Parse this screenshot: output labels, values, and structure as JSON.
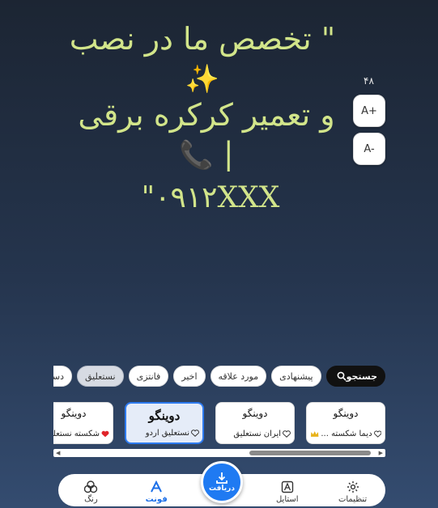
{
  "canvas": {
    "line1": "\" تخصص ما در نصب",
    "line2": "و تعمیر کرکره برقی |",
    "line3": "\"۰۹۱۲XXX",
    "sparkles_emoji": "✨",
    "phone_emoji": "📞",
    "text_color": "#d2e58a"
  },
  "size_control": {
    "value": "۴۸",
    "increase_label": "A+",
    "decrease_label": "A-"
  },
  "categories": {
    "search_label": "جستجو",
    "items": [
      "پیشنهادی",
      "مورد علاقه",
      "اخیر",
      "فانتزی",
      "نستعلیق",
      "دست‌نویس"
    ],
    "active": "نستعلیق"
  },
  "fonts": [
    {
      "preview": "دوینگو",
      "name": "دیما شکسته ...",
      "badge": "crown-icon"
    },
    {
      "preview": "دوینگو",
      "name": "ایران نستعلیق",
      "badge": "heart-outline-icon"
    },
    {
      "preview": "دوینگو",
      "name": "نستعلیق اردو",
      "badge": "heart-outline-icon",
      "selected": true
    },
    {
      "preview": "دوینگو",
      "name": "شکسته نستعلیق",
      "badge": "heart-filled-icon"
    }
  ],
  "nav": {
    "settings": "تنظیمات",
    "style": "استایل",
    "download": "دریافت",
    "font": "فونت",
    "color": "رنگ"
  },
  "colors": {
    "accent": "#1f7af2",
    "heart": "#e0242a",
    "crown": "#e8b21a"
  }
}
